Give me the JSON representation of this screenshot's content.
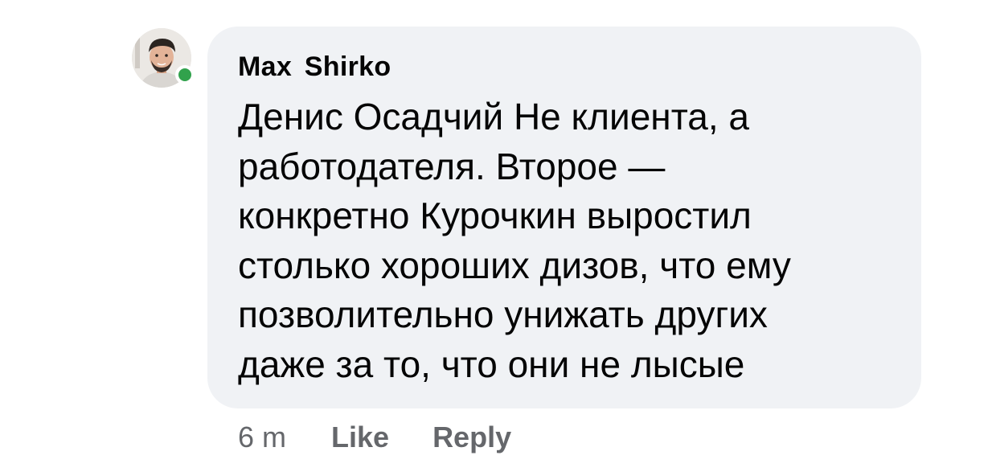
{
  "comment": {
    "author": "Max  Shirko",
    "text": "Денис Осадчий Не клиента, а\nработодателя. Второе —\nконкретно Курочкин выростил\nстолько хороших дизов, что ему\nпозволительно унижать других\nдаже за то, что они не лысые",
    "online": true,
    "timestamp": "6 m",
    "actions": {
      "like_label": "Like",
      "reply_label": "Reply"
    }
  },
  "colors": {
    "bubble_background": "#f0f2f5",
    "text": "#050505",
    "secondary_text": "#65676b",
    "online_indicator": "#31a24c"
  },
  "icons": {
    "avatar": "user-photo",
    "presence": "online-dot"
  }
}
